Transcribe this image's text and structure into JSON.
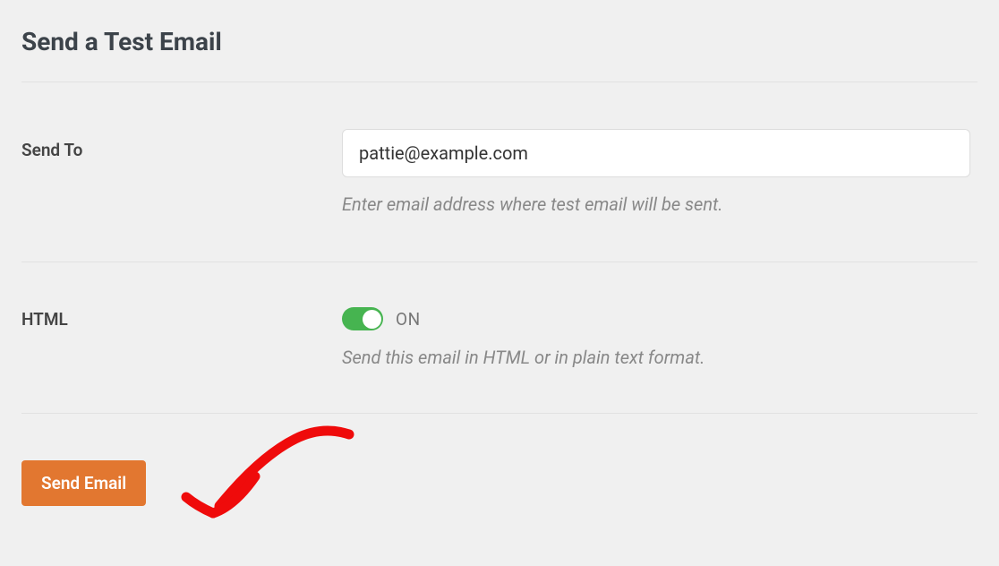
{
  "header": {
    "title": "Send a Test Email"
  },
  "form": {
    "send_to": {
      "label": "Send To",
      "value": "pattie@example.com",
      "help": "Enter email address where test email will be sent."
    },
    "html": {
      "label": "HTML",
      "status": "ON",
      "help": "Send this email in HTML or in plain text format."
    },
    "submit": {
      "label": "Send Email"
    }
  },
  "colors": {
    "accent": "#e27730",
    "toggle_on": "#46b450",
    "annotation": "#ef0b0b"
  }
}
